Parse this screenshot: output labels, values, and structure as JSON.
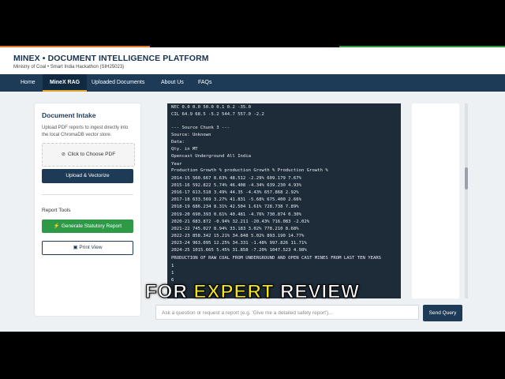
{
  "header": {
    "title": "MINEX • DOCUMENT INTELLIGENCE PLATFORM",
    "subtitle": "Ministry of Coal • Smart India Hackathon (SIH25023)"
  },
  "nav": {
    "items": [
      "Home",
      "MineX RAG",
      "Uploaded Documents",
      "About Us",
      "FAQs"
    ],
    "active": "MineX RAG"
  },
  "intake": {
    "title": "Document Intake",
    "description": "Upload PDF reports to ingest directly into the local ChromaDB vector store.",
    "file_button": "Click to Choose PDF",
    "upload_button": "Upload & Vectorize",
    "tools_label": "Report Tools",
    "report_button": "Generate Statutory Report",
    "print_button": "Print View"
  },
  "output_lines": [
    "NEC 0.0 0.0 50.0 0.1 0.2 -35.0",
    "CIL 64.9 68.5 -5.2 544.7 557.0 -2.2",
    "",
    "--- Source Chunk 3 ---",
    "Source: Unknown",
    "Data:",
    "Qty. in MT",
    "Opencast Underground All India",
    "Year",
    "Production Growth % production Growth % Production Growth %",
    "2014-15 560.667 8.63% 48.512 -2.29% 609.179 7.67%",
    "2015-16 592.822 5.74% 46.408 -4.34% 639.230 4.93%",
    "2016-17 613.518 3.49% 44.35 -4.43% 657.868 2.92%",
    "2017-18 633.569 3.27% 41.831 -5.68% 675.400 2.66%",
    "2018-19 686.234 8.31% 42.504 1.61% 728.738 7.89%",
    "2019-20 690.393 0.61% 40.481 -4.76% 730.874 0.30%",
    "2020-21 683.872 -0.94% 32.211 -20.43% 716.083 -2.02%",
    "2021-22 745.027 8.94% 33.183 3.02% 778.210 8.68%",
    "2022-23 858.342 15.21% 34.848 5.02% 893.190 14.77%",
    "2023-24 963.095 12.25% 34.331 -1.48% 997.826 11.71%",
    "2024-25 1015.665 5.45% 31.858 -7.20% 1047.523 4.98%",
    "PRODUCTION OF RAW COAL FROM UNDERGROUND AND OPEN CAST MINES FROM LAST TEN YEARS",
    "1",
    "1",
    "6"
  ],
  "query": {
    "placeholder": "Ask a question or request a report (e.g. 'Give me a detailed safety report')...",
    "send_button": "Send Query"
  },
  "caption": {
    "word1": "FOR",
    "word2": "EXPERT",
    "word3": "REVIEW"
  },
  "colors": {
    "navy": "#1d3b57",
    "green": "#2e9a47",
    "orange": "#e07b2c",
    "caption_yellow": "#f5e61c"
  }
}
